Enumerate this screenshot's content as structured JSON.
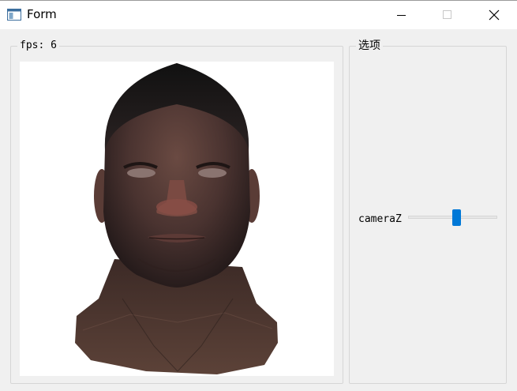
{
  "window": {
    "title": "Form"
  },
  "title_bar_controls": {
    "minimize": "minimize-icon",
    "maximize": "maximize-icon",
    "close": "close-icon"
  },
  "render_group": {
    "title": "fps: 6"
  },
  "options_group": {
    "title": "选项",
    "slider": {
      "label": "cameraZ",
      "value_fraction": 0.55
    }
  },
  "colors": {
    "accent": "#0078d7",
    "panel_bg": "#f0f0f0",
    "viewport_bg": "#ffffff"
  }
}
